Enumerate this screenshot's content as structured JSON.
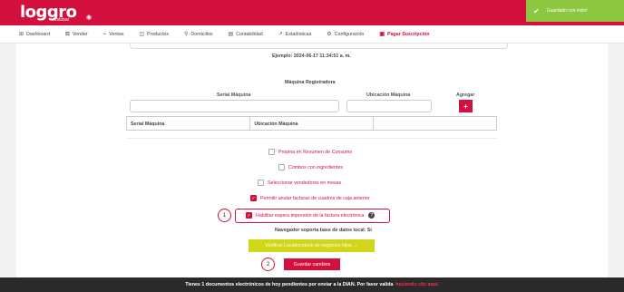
{
  "brand": {
    "logo": "loggro",
    "sub": "restobar",
    "accent": "#d3103d"
  },
  "toast": {
    "message": "Guardado con éxito!"
  },
  "nav": [
    {
      "icon": "⊞",
      "label": "Dashboard"
    },
    {
      "icon": "⛾",
      "label": "Vender"
    },
    {
      "icon": "⌁",
      "label": "Ventas"
    },
    {
      "icon": "◫",
      "label": "Productos"
    },
    {
      "icon": "⚲",
      "label": "Domicilios"
    },
    {
      "icon": "▤",
      "label": "Contabilidad"
    },
    {
      "icon": "↗",
      "label": "Estadísticas"
    },
    {
      "icon": "⚙",
      "label": "Configuración"
    },
    {
      "icon": "▣",
      "label": "Pagar Suscripción"
    }
  ],
  "example_text": "Ejemplo: 2024-06-17 11:34:51 a. m.",
  "register": {
    "title": "Máquina Registradora",
    "serial_label": "Serial Máquina",
    "location_label": "Ubicación Máquina",
    "add_label": "Agregar",
    "add_symbol": "+",
    "table_headers": [
      "Serial Máquina",
      "Ubicación Máquina",
      ""
    ]
  },
  "options": {
    "propina": "Propina en Resumen de Consumo",
    "combos": "Combos con ingredientes",
    "vendedores": "Seleccionar vendedores en mesas",
    "anular": "Permitir anular facturas de cuadres de caja anterior",
    "impresion": "Habilitar espera impresión de la factura electrónica"
  },
  "db_note": "Navegador soporta base de datos local: Si",
  "verify_label": "Verificar Locationstock de negocios hijos ↔",
  "save_label": "Guardar cambios",
  "badges": {
    "one": "1",
    "two": "2"
  },
  "footer": {
    "text": "Tienes 1 documentos electrónicos de hoy pendientes por enviar a la DIAN. Por favor valida",
    "link": "haciendo clic aquí."
  }
}
